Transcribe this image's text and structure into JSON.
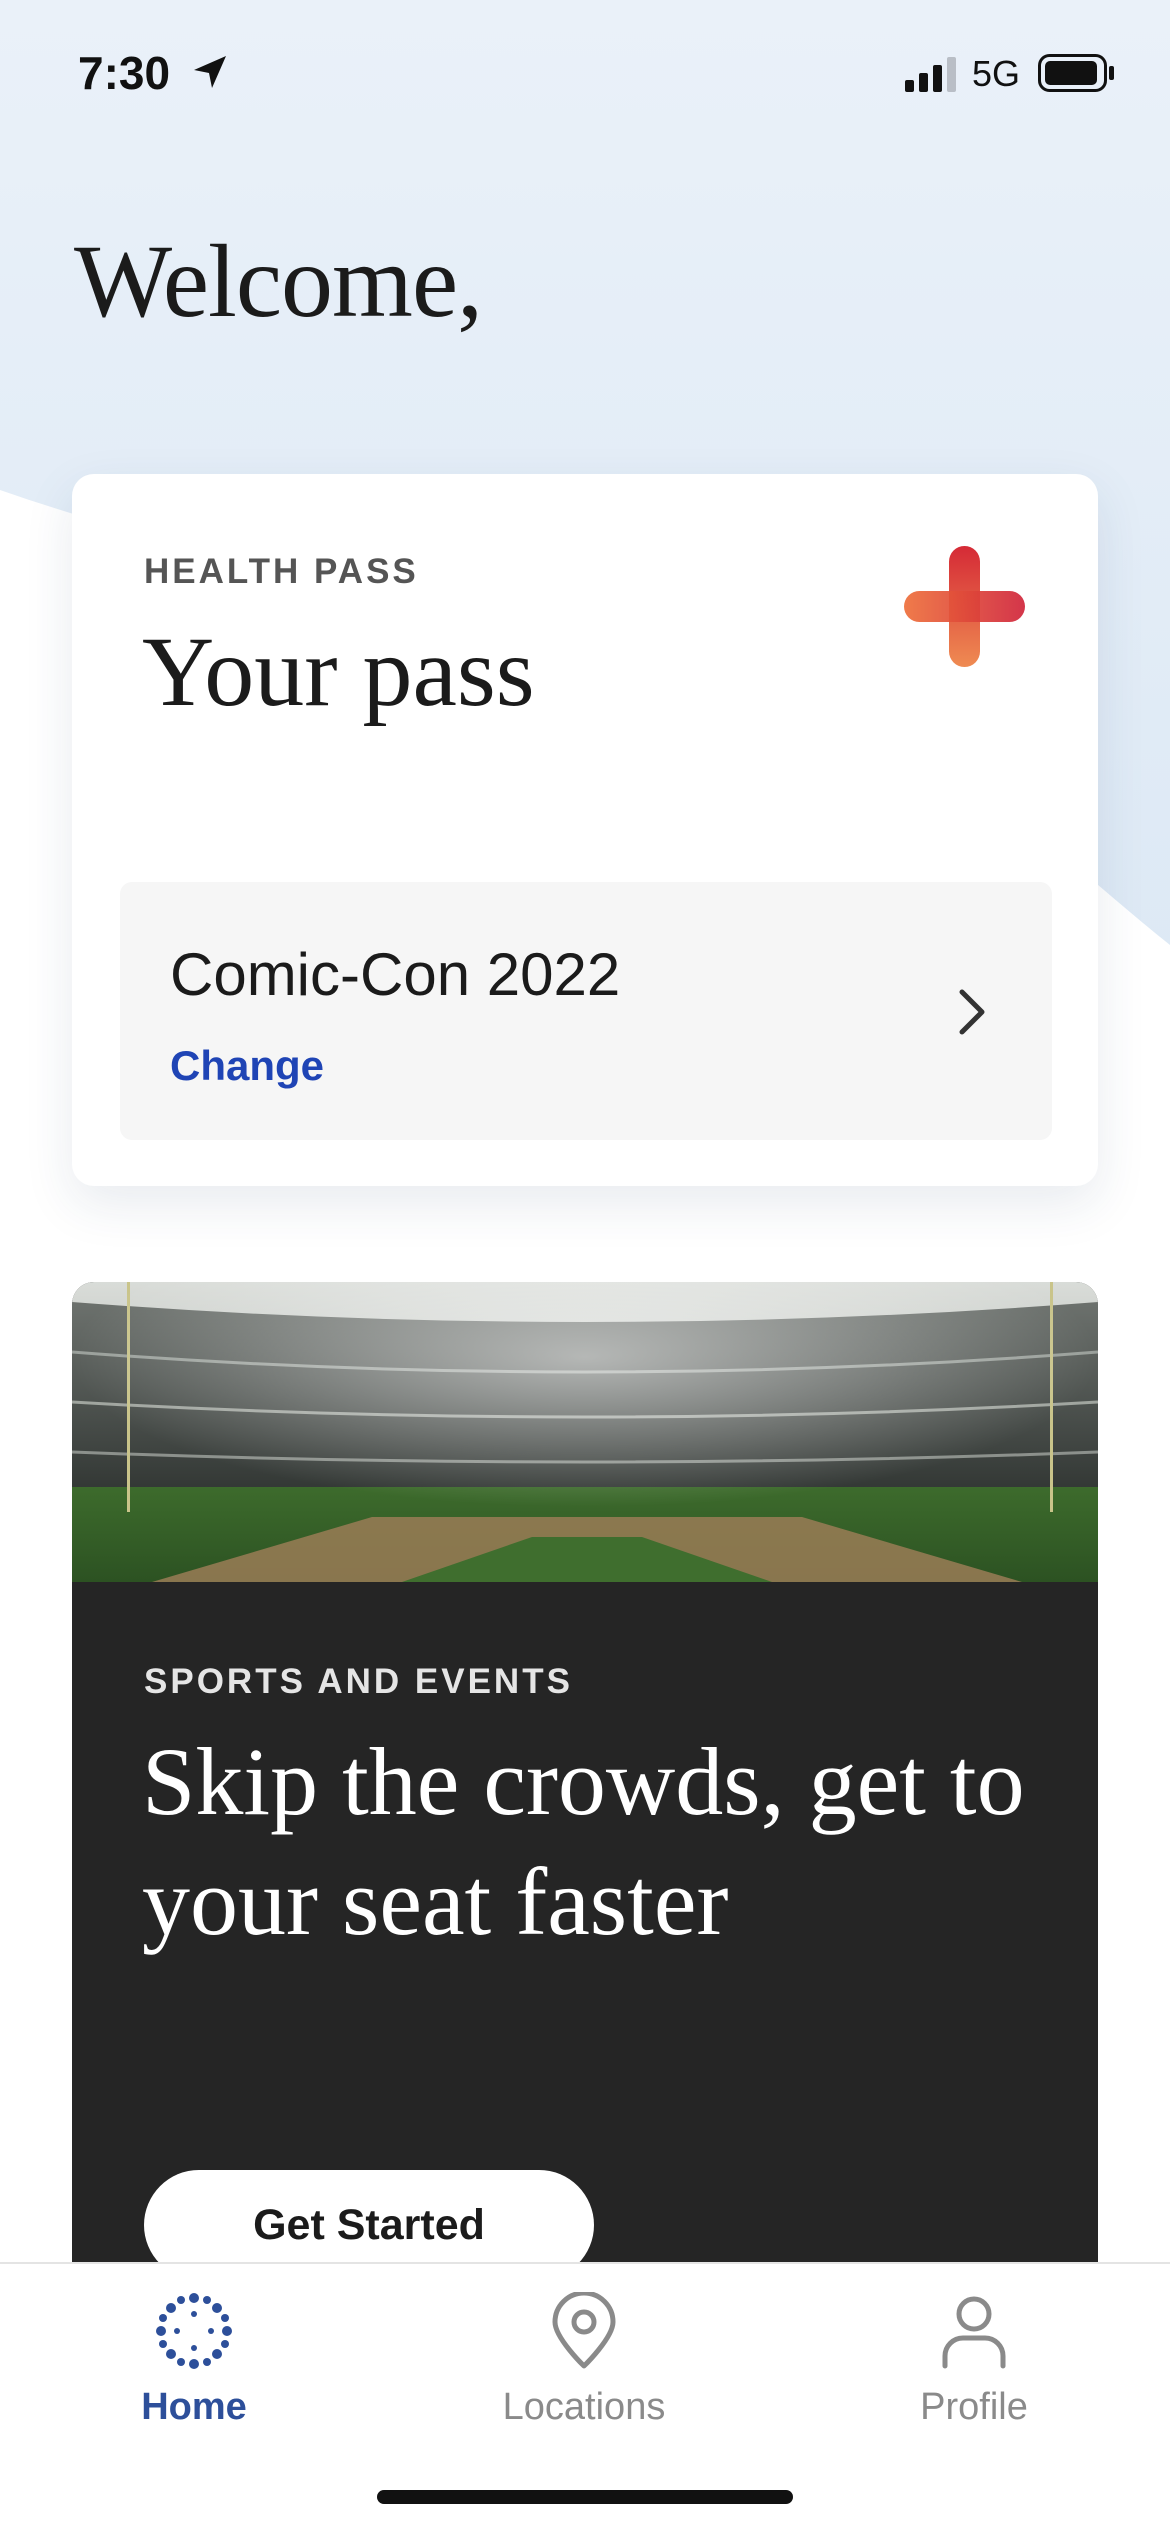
{
  "status_bar": {
    "time": "7:30",
    "network": "5G"
  },
  "welcome": {
    "text": "Welcome,"
  },
  "health_pass": {
    "eyebrow": "HEALTH PASS",
    "title": "Your pass",
    "event": {
      "name": "Comic-Con 2022",
      "change_label": "Change"
    }
  },
  "promo": {
    "eyebrow": "SPORTS AND EVENTS",
    "title": "Skip the crowds, get to your seat faster",
    "button_label": "Get Started"
  },
  "tab_bar": {
    "items": [
      {
        "label": "Home",
        "icon": "home-dots-icon",
        "active": true
      },
      {
        "label": "Locations",
        "icon": "location-pin-icon",
        "active": false
      },
      {
        "label": "Profile",
        "icon": "profile-icon",
        "active": false
      }
    ]
  },
  "colors": {
    "accent_blue": "#2d4f9a",
    "link_blue": "#1f44b5",
    "plus_red": "#d6303a",
    "plus_orange": "#ee7a3e",
    "promo_bg": "#252525"
  }
}
